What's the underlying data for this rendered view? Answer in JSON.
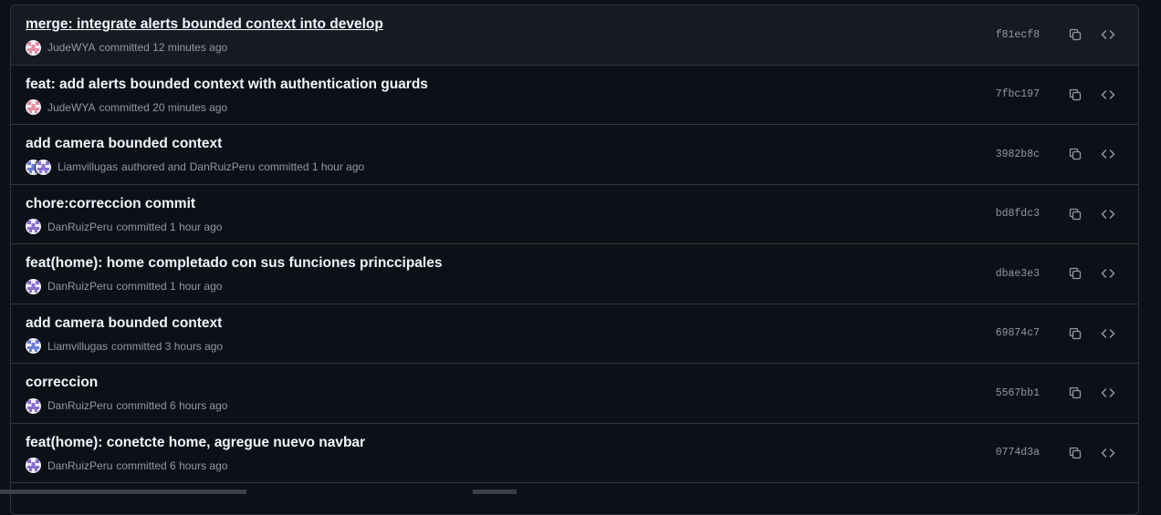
{
  "commits": [
    {
      "title": "merge: integrate alerts bounded context into develop",
      "author": "JudeWYA",
      "action": "committed 12 minutes ago",
      "co_author": "",
      "co_action": "",
      "sha": "f81ecf8",
      "avatar": "pink",
      "avatar2": "",
      "highlight": true
    },
    {
      "title": "feat: add alerts bounded context with authentication guards",
      "author": "JudeWYA",
      "action": "committed 20 minutes ago",
      "co_author": "",
      "co_action": "",
      "sha": "7fbc197",
      "avatar": "pink",
      "avatar2": "",
      "highlight": false
    },
    {
      "title": "add camera bounded context",
      "author": "Liamvillugas",
      "action": "authored and",
      "co_author": "DanRuizPeru",
      "co_action": "committed 1 hour ago",
      "sha": "3982b8c",
      "avatar": "blue",
      "avatar2": "purple",
      "highlight": false
    },
    {
      "title": "chore:correccion commit",
      "author": "DanRuizPeru",
      "action": "committed 1 hour ago",
      "co_author": "",
      "co_action": "",
      "sha": "bd8fdc3",
      "avatar": "purple",
      "avatar2": "",
      "highlight": false
    },
    {
      "title": "feat(home): home completado con sus funciones princcipales",
      "author": "DanRuizPeru",
      "action": "committed 1 hour ago",
      "co_author": "",
      "co_action": "",
      "sha": "dbae3e3",
      "avatar": "purple",
      "avatar2": "",
      "highlight": false
    },
    {
      "title": "add camera bounded context",
      "author": "Liamvillugas",
      "action": "committed 3 hours ago",
      "co_author": "",
      "co_action": "",
      "sha": "69874c7",
      "avatar": "blue",
      "avatar2": "",
      "highlight": false
    },
    {
      "title": "correccion",
      "author": "DanRuizPeru",
      "action": "committed 6 hours ago",
      "co_author": "",
      "co_action": "",
      "sha": "5567bb1",
      "avatar": "purple",
      "avatar2": "",
      "highlight": false
    },
    {
      "title": "feat(home): conetcte home, agregue nuevo navbar",
      "author": "DanRuizPeru",
      "action": "committed 6 hours ago",
      "co_author": "",
      "co_action": "",
      "sha": "0774d3a",
      "avatar": "purple",
      "avatar2": "",
      "highlight": false
    }
  ],
  "icons": {
    "copy": "copy-icon",
    "browse": "code-icon"
  },
  "colors": {
    "background": "#0d1117",
    "row_highlight": "#161b22",
    "border": "#30363d",
    "title": "#f0f6fc",
    "muted": "#9198a1",
    "avatar_pink": "#e88ba0",
    "avatar_purple": "#8a6fd1",
    "avatar_blue": "#6a7fd6"
  }
}
